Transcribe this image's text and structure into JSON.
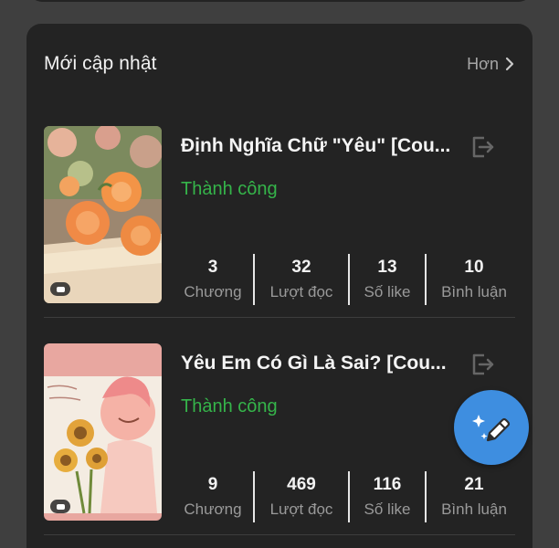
{
  "section": {
    "title": "Mới cập nhật",
    "more_label": "Hơn"
  },
  "stories": [
    {
      "title": "Định Nghĩa Chữ \"Yêu\" [Cou...",
      "status": "Thành công",
      "status_color": "#35b44a",
      "stats": [
        {
          "value": "3",
          "label": "Chương"
        },
        {
          "value": "32",
          "label": "Lượt đọc"
        },
        {
          "value": "13",
          "label": "Số like"
        },
        {
          "value": "10",
          "label": "Bình luận"
        }
      ]
    },
    {
      "title": "Yêu Em Có Gì Là Sai? [Cou...",
      "status": "Thành công",
      "status_color": "#35b44a",
      "stats": [
        {
          "value": "9",
          "label": "Chương"
        },
        {
          "value": "469",
          "label": "Lượt đọc"
        },
        {
          "value": "116",
          "label": "Số like"
        },
        {
          "value": "21",
          "label": "Bình luận"
        }
      ]
    }
  ],
  "fab": {
    "icon": "magic-pen-icon",
    "color": "#3e8ee0"
  }
}
